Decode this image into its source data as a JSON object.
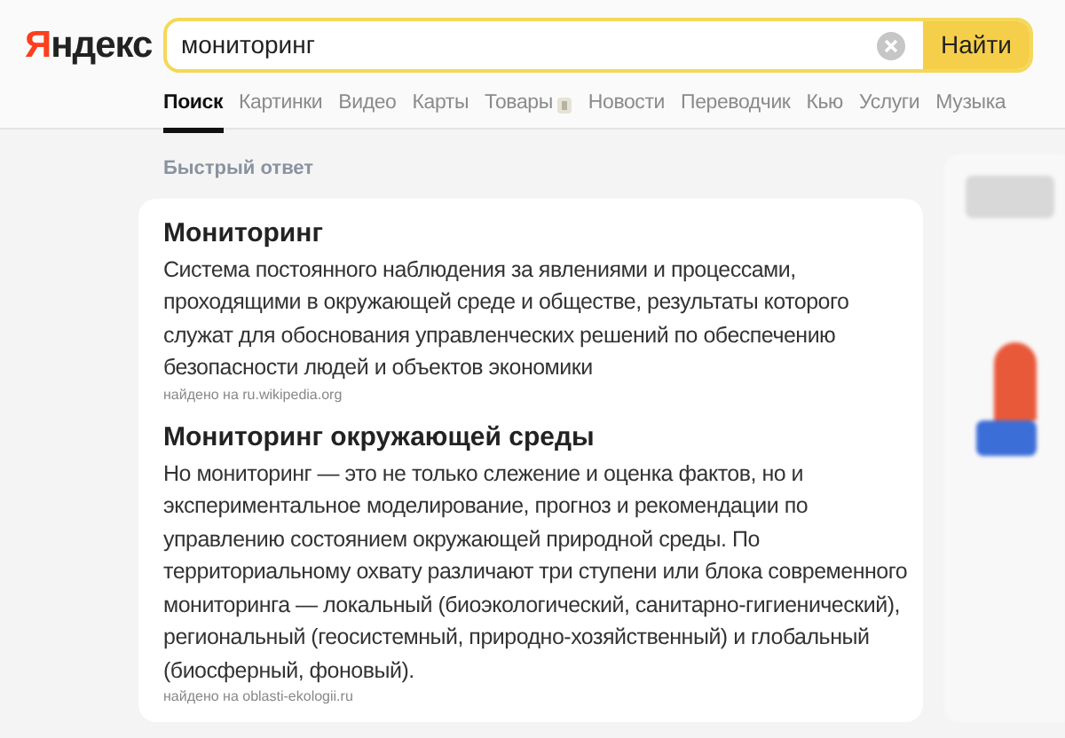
{
  "logo": "Яндекс",
  "search": {
    "value": "мониторинг",
    "button": "Найти"
  },
  "tabs": [
    {
      "label": "Поиск",
      "selected": true
    },
    {
      "label": "Картинки",
      "selected": false
    },
    {
      "label": "Видео",
      "selected": false
    },
    {
      "label": "Карты",
      "selected": false
    },
    {
      "label": "Товары",
      "selected": false,
      "badge": true
    },
    {
      "label": "Новости",
      "selected": false
    },
    {
      "label": "Переводчик",
      "selected": false
    },
    {
      "label": "Кью",
      "selected": false
    },
    {
      "label": "Услуги",
      "selected": false
    },
    {
      "label": "Музыка",
      "selected": false
    }
  ],
  "section_title": "Быстрый ответ",
  "answers": [
    {
      "title": "Мониторинг",
      "text": "Система постоянного наблюдения за явлениями и процессами, проходящими в окружающей среде и обществе, результаты которого служат для обоснования управленческих решений по обеспечению безопасности людей и объектов экономики",
      "source": "найдено на ru.wikipedia.org"
    },
    {
      "title": "Мониторинг окружающей среды",
      "text": "Но мониторинг — это не только слежение и оценка фактов, но и экспериментальное моделирование, прогноз и рекомендации по управлению состоянием окружающей природной среды. По территориальному охвату различают три ступени или блока современного мониторинга — локальный (биоэкологический, санитарно-гигиенический), региональный (геосистемный, природно-хозяйственный) и глобальный (биосферный, фоновый).",
      "source": "найдено на oblasti-ekologii.ru"
    }
  ]
}
